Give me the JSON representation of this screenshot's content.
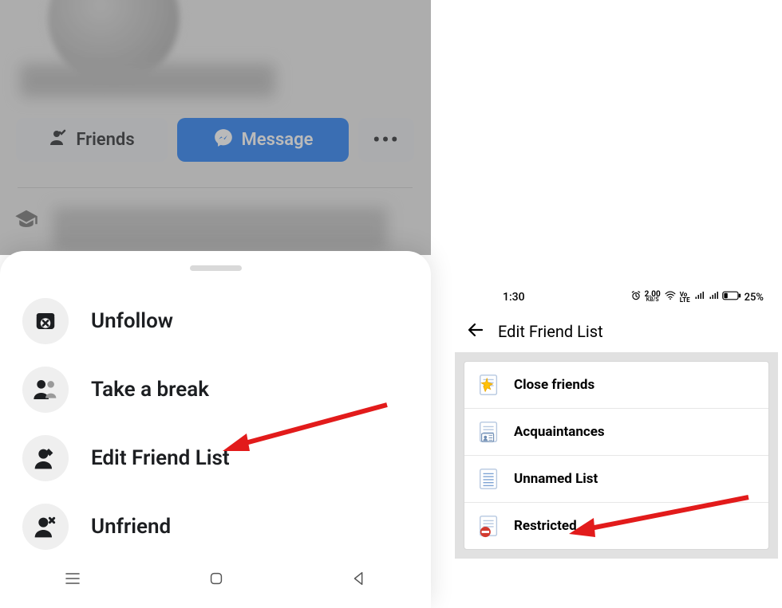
{
  "left": {
    "buttons": {
      "friends": "Friends",
      "message": "Message",
      "more": "•••"
    },
    "sheet": [
      {
        "id": "unfollow",
        "label": "Unfollow"
      },
      {
        "id": "take-a-break",
        "label": "Take a break"
      },
      {
        "id": "edit-friend-list",
        "label": "Edit Friend List"
      },
      {
        "id": "unfriend",
        "label": "Unfriend"
      }
    ]
  },
  "right": {
    "status": {
      "time": "1:30",
      "speed": "2.00",
      "speed_unit": "KB/S",
      "lte": "Vo LTE",
      "battery": "25%"
    },
    "header": "Edit Friend List",
    "lists": [
      {
        "id": "close-friends",
        "label": "Close friends"
      },
      {
        "id": "acquaintances",
        "label": "Acquaintances"
      },
      {
        "id": "unnamed-list",
        "label": "Unnamed List"
      },
      {
        "id": "restricted",
        "label": "Restricted"
      }
    ]
  }
}
